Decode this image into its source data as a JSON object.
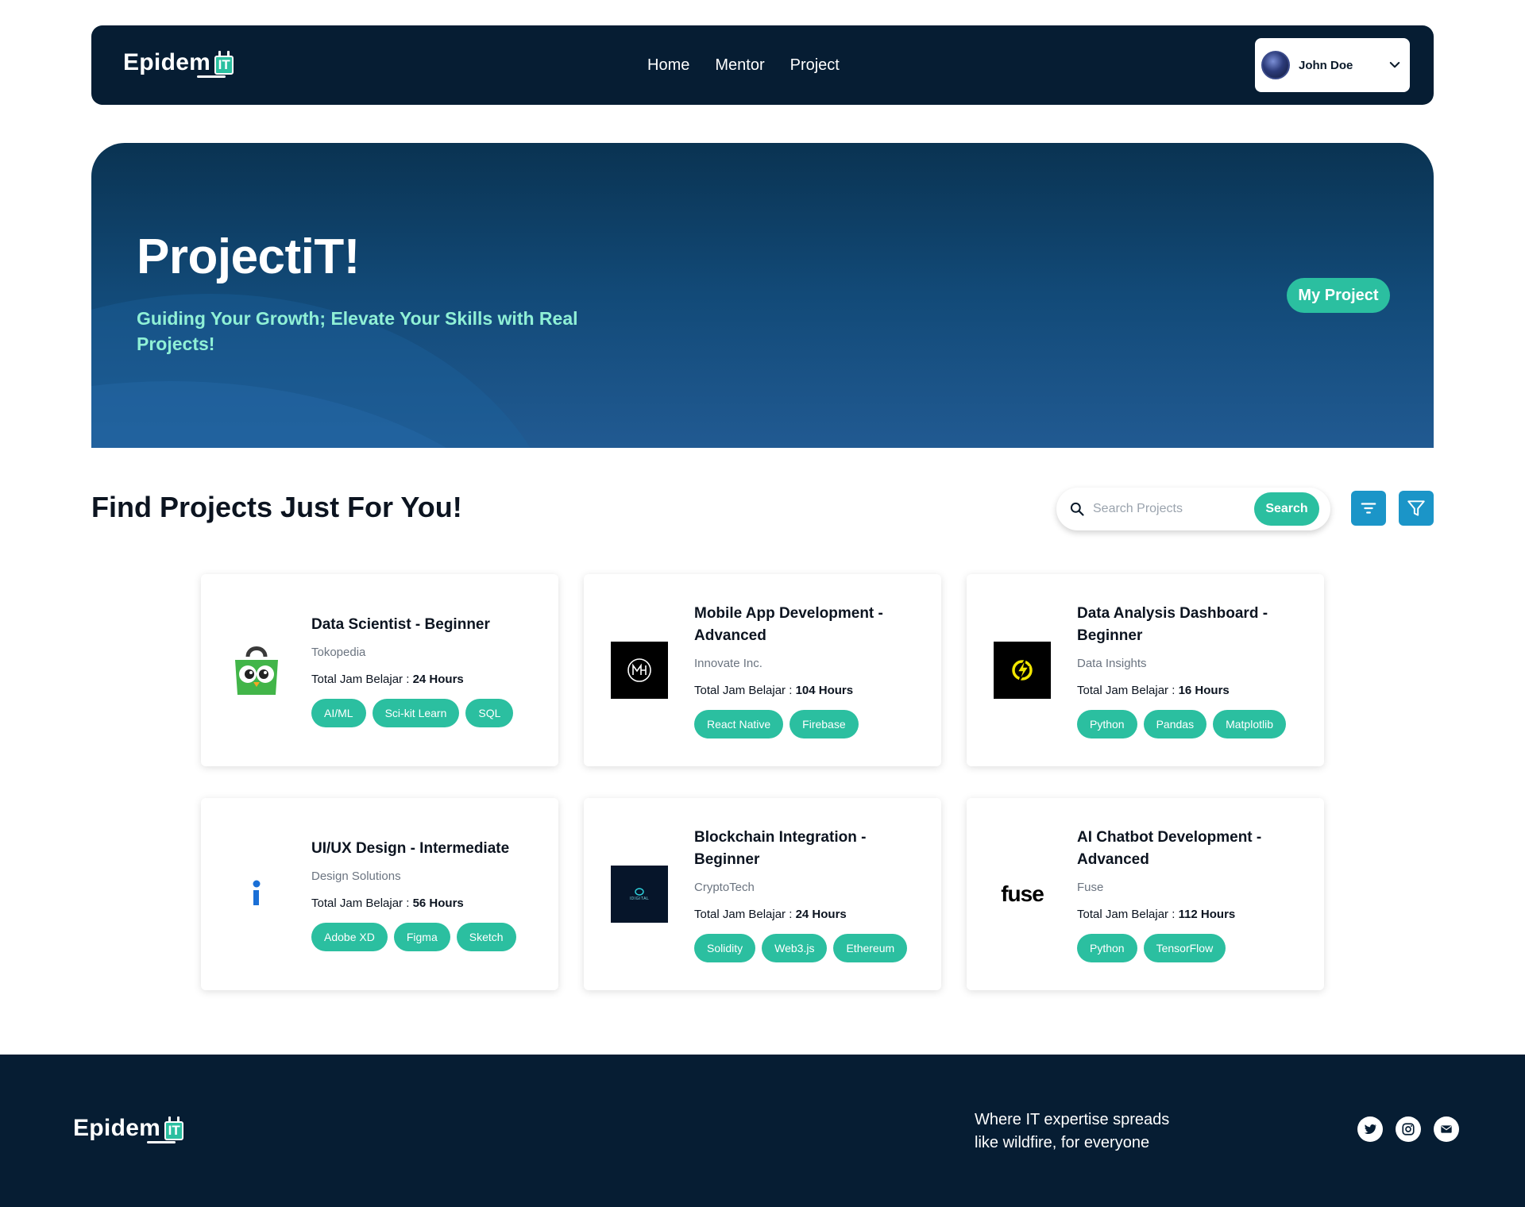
{
  "brand": {
    "word": "Epidem",
    "badge": "IT"
  },
  "nav": {
    "links": [
      "Home",
      "Mentor",
      "Project"
    ]
  },
  "user": {
    "name": "John Doe"
  },
  "hero": {
    "title": "ProjectiT!",
    "subtitle": "Guiding Your Growth; Elevate Your Skills with Real Projects!",
    "button": "My Project"
  },
  "section": {
    "title": "Find Projects Just For You!"
  },
  "search": {
    "placeholder": "Search Projects",
    "button": "Search"
  },
  "hours_label": "Total Jam Belajar : ",
  "projects": [
    {
      "title": "Data Scientist - Beginner",
      "company": "Tokopedia",
      "hours": "24 Hours",
      "tags": [
        "AI/ML",
        "Sci-kit Learn",
        "SQL"
      ],
      "logo": "tokopedia-owl"
    },
    {
      "title": "Mobile App Development - Advanced",
      "company": "Innovate Inc.",
      "hours": "104 Hours",
      "tags": [
        "React Native",
        "Firebase"
      ],
      "logo": "mh-monogram"
    },
    {
      "title": "Data Analysis Dashboard - Beginner",
      "company": "Data Insights",
      "hours": "16 Hours",
      "tags": [
        "Python",
        "Pandas",
        "Matplotlib"
      ],
      "logo": "lightning-circle"
    },
    {
      "title": "UI/UX Design - Intermediate",
      "company": "Design Solutions",
      "hours": "56 Hours",
      "tags": [
        "Adobe XD",
        "Figma",
        "Sketch"
      ],
      "logo": "i-letter"
    },
    {
      "title": "Blockchain Integration - Beginner",
      "company": "CryptoTech",
      "hours": "24 Hours",
      "tags": [
        "Solidity",
        "Web3.js",
        "Ethereum"
      ],
      "logo": "idigital"
    },
    {
      "title": "AI Chatbot Development - Advanced",
      "company": "Fuse",
      "hours": "112 Hours",
      "tags": [
        "Python",
        "TensorFlow"
      ],
      "logo": "fuse-wordmark"
    }
  ],
  "logo_text": {
    "idigital": "IDIGITAL",
    "fuse": "fuse"
  },
  "footer": {
    "tagline": "Where IT expertise spreads like wildfire, for everyone"
  },
  "colors": {
    "navy": "#061d33",
    "teal": "#2bbfa0",
    "blue": "#1b95c8",
    "mint": "#8ff0d6"
  }
}
